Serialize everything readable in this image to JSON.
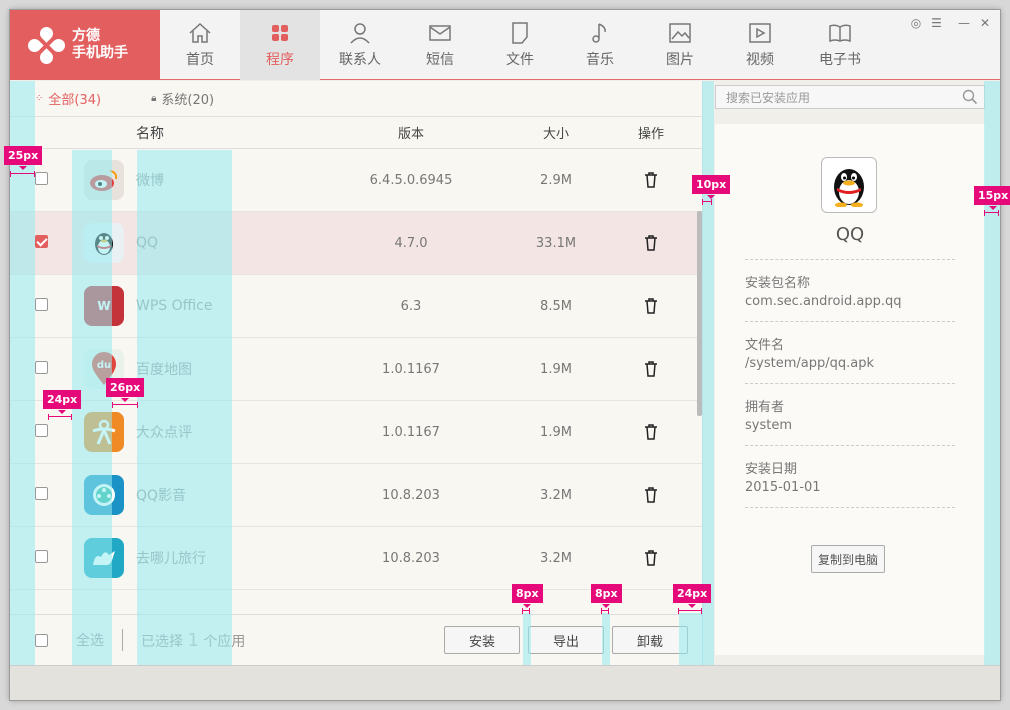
{
  "brand": {
    "line1": "方德",
    "line2": "手机助手"
  },
  "nav": [
    {
      "label": "首页",
      "icon": "home-icon"
    },
    {
      "label": "程序",
      "icon": "apps-icon",
      "active": true
    },
    {
      "label": "联系人",
      "icon": "contact-icon"
    },
    {
      "label": "短信",
      "icon": "mail-icon"
    },
    {
      "label": "文件",
      "icon": "file-icon"
    },
    {
      "label": "音乐",
      "icon": "music-icon"
    },
    {
      "label": "图片",
      "icon": "image-icon"
    },
    {
      "label": "视频",
      "icon": "video-icon"
    },
    {
      "label": "电子书",
      "icon": "book-icon"
    }
  ],
  "filters": {
    "all": "全部(34)",
    "system": "系统(20)"
  },
  "columns": {
    "name": "名称",
    "version": "版本",
    "size": "大小",
    "action": "操作"
  },
  "apps": [
    {
      "name": "微博",
      "version": "6.4.5.0.6945",
      "size": "2.9M",
      "checked": false,
      "icon": "weibo-icon",
      "color": "#e7e2db",
      "glyph": ""
    },
    {
      "name": "QQ",
      "version": "4.7.0",
      "size": "33.1M",
      "checked": true,
      "icon": "qq-icon",
      "color": "#e9f1f4",
      "glyph": ""
    },
    {
      "name": "WPS Office",
      "version": "6.3",
      "size": "8.5M",
      "checked": false,
      "icon": "wps-icon",
      "color": "#c4323a",
      "glyph": "W"
    },
    {
      "name": "百度地图",
      "version": "1.0.1167",
      "size": "1.9M",
      "checked": false,
      "icon": "baidu-map-icon",
      "color": "#e9f1ea",
      "glyph": "du"
    },
    {
      "name": "大众点评",
      "version": "1.0.1167",
      "size": "1.9M",
      "checked": false,
      "icon": "dianping-icon",
      "color": "#f08a25",
      "glyph": ""
    },
    {
      "name": "QQ影音",
      "version": "10.8.203",
      "size": "3.2M",
      "checked": false,
      "icon": "qq-player-icon",
      "color": "#1b92c6",
      "glyph": ""
    },
    {
      "name": "去哪儿旅行",
      "version": "10.8.203",
      "size": "3.2M",
      "checked": false,
      "icon": "qunar-icon",
      "color": "#20a8c4",
      "glyph": ""
    }
  ],
  "footer": {
    "select_all": "全选",
    "selected_prefix": "已选择",
    "selected_count": "1",
    "selected_suffix": "个应用",
    "install": "安装",
    "export": "导出",
    "uninstall": "卸载"
  },
  "search": {
    "placeholder": "搜索已安装应用"
  },
  "detail": {
    "name": "QQ",
    "fields": [
      {
        "label": "安装包名称",
        "value": "com.sec.android.app.qq"
      },
      {
        "label": "文件名",
        "value": "/system/app/qq.apk"
      },
      {
        "label": "拥有者",
        "value": "system"
      },
      {
        "label": "安装日期",
        "value": "2015-01-01"
      }
    ],
    "copy_button": "复制到电脑"
  },
  "annotations": [
    "25px",
    "24px",
    "26px",
    "10px",
    "15px",
    "8px",
    "8px",
    "24px"
  ],
  "colors": {
    "brand": "#e35f5f",
    "guide": "#96ebf0",
    "tag": "#e6097a"
  }
}
